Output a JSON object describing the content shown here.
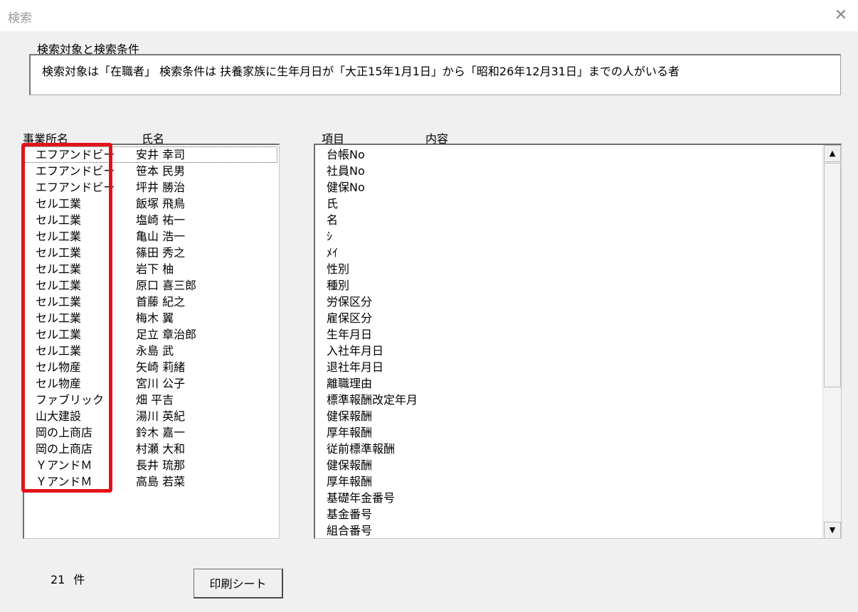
{
  "window": {
    "title": "検索",
    "close_glyph": "✕"
  },
  "condition": {
    "label": "検索対象と検索条件",
    "text": "検索対象は「在職者」 検索条件は 扶養家族に生年月日が「大正15年1月1日」から「昭和26年12月31日」までの人がいる者"
  },
  "left_list": {
    "headers": [
      "事業所名",
      "氏名"
    ],
    "rows": [
      [
        "エフアンドビー",
        "安井 幸司"
      ],
      [
        "エフアンドビー",
        "笹本 民男"
      ],
      [
        "エフアンドビー",
        "坪井 勝治"
      ],
      [
        "セル工業",
        "飯塚 飛鳥"
      ],
      [
        "セル工業",
        "塩崎 祐一"
      ],
      [
        "セル工業",
        "亀山 浩一"
      ],
      [
        "セル工業",
        "篠田 秀之"
      ],
      [
        "セル工業",
        "岩下 柚"
      ],
      [
        "セル工業",
        "原口 喜三郎"
      ],
      [
        "セル工業",
        "首藤 紀之"
      ],
      [
        "セル工業",
        "梅木 翼"
      ],
      [
        "セル工業",
        "足立 章治郎"
      ],
      [
        "セル工業",
        "永島 武"
      ],
      [
        "セル物産",
        "矢崎 莉緒"
      ],
      [
        "セル物産",
        "宮川 公子"
      ],
      [
        "ファブリック",
        "畑 平吉"
      ],
      [
        "山大建設",
        "湯川 英紀"
      ],
      [
        "岡の上商店",
        "鈴木 嘉一"
      ],
      [
        "岡の上商店",
        "村瀬 大和"
      ],
      [
        "ＹアンドＭ",
        "長井 琉那"
      ],
      [
        "ＹアンドＭ",
        "高島 若菜"
      ]
    ]
  },
  "right_list": {
    "headers": [
      "項目",
      "内容"
    ],
    "items": [
      "台帳No",
      "社員No",
      "健保No",
      "氏",
      "名",
      "ｼ",
      "ﾒｲ",
      "性別",
      "種別",
      "労保区分",
      "雇保区分",
      "生年月日",
      "入社年月日",
      "退社年月日",
      "離職理由",
      "標準報酬改定年月",
      "健保報酬",
      "厚年報酬",
      "従前標準報酬",
      "健保報酬",
      "厚年報酬",
      "基礎年金番号",
      "基金番号",
      "組合番号"
    ]
  },
  "scroll": {
    "up_glyph": "▲",
    "down_glyph": "▼"
  },
  "footer": {
    "count": "21",
    "count_unit": "件",
    "print_button": "印刷シート"
  },
  "colors": {
    "highlight": "#e31218"
  }
}
